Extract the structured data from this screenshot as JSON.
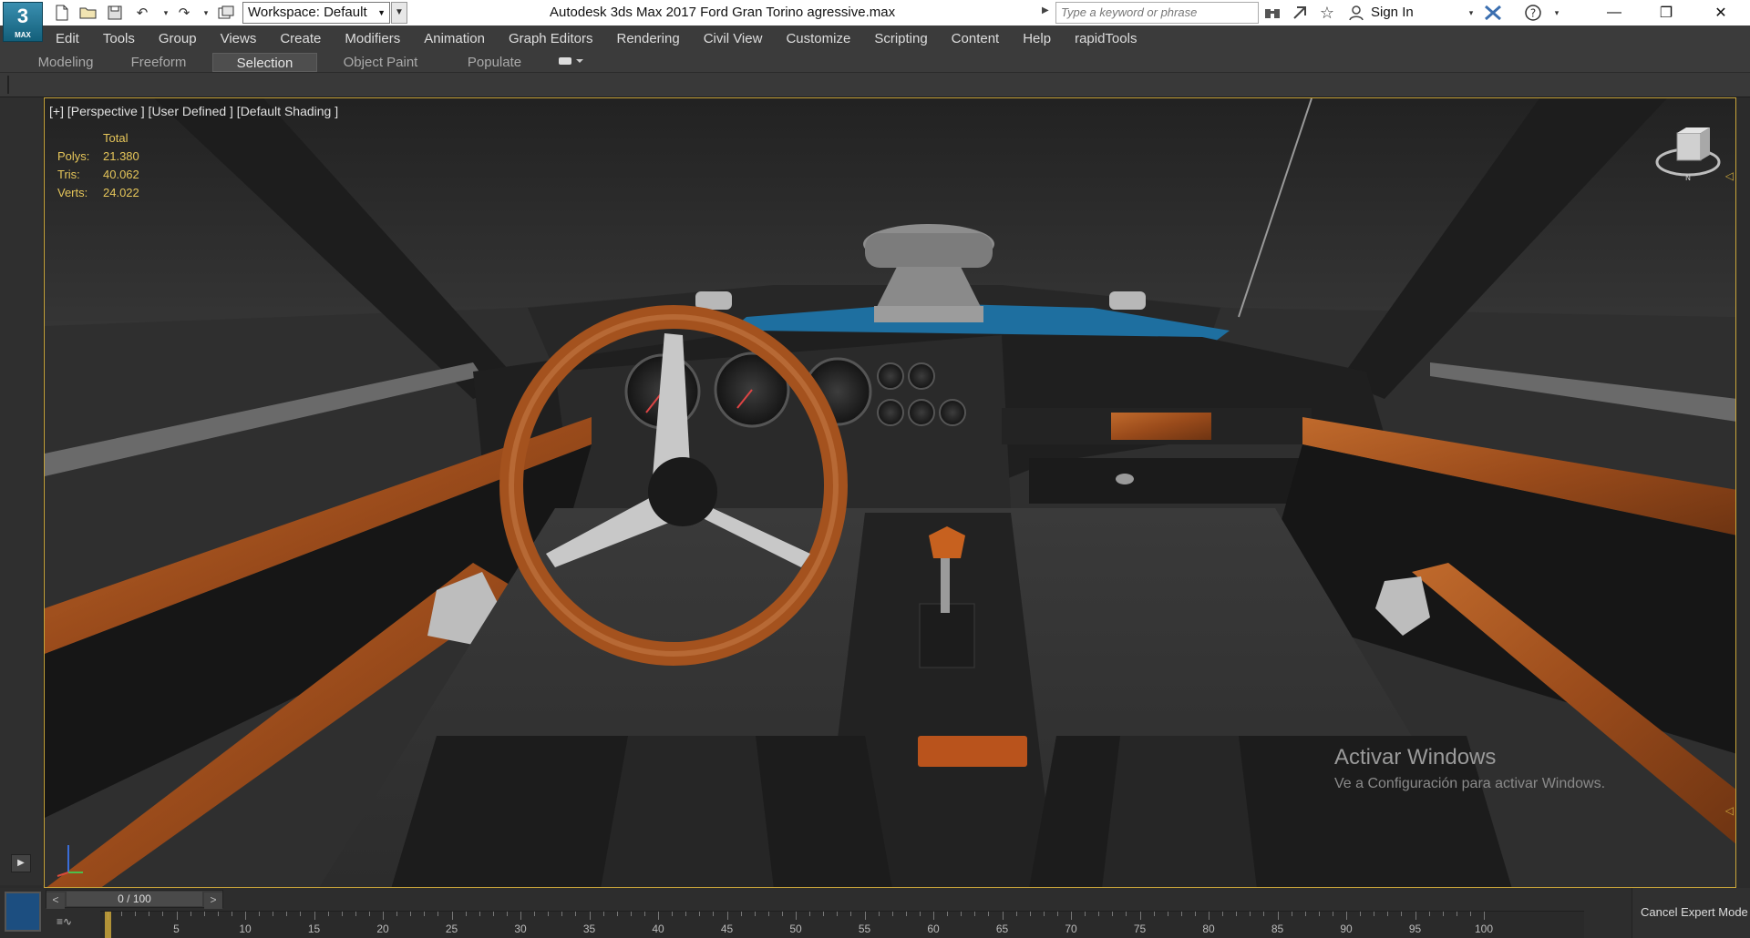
{
  "titlebar": {
    "logo_text": "3",
    "logo_sub": "MAX",
    "workspace": "Workspace: Default",
    "window_title": "Autodesk 3ds Max 2017     Ford Gran Torino agressive.max",
    "search_placeholder": "Type a keyword or phrase",
    "sign_in": "Sign In"
  },
  "menu": [
    "Edit",
    "Tools",
    "Group",
    "Views",
    "Create",
    "Modifiers",
    "Animation",
    "Graph Editors",
    "Rendering",
    "Civil View",
    "Customize",
    "Scripting",
    "Content",
    "Help",
    "rapidTools"
  ],
  "ribbon": {
    "tabs": [
      "Modeling",
      "Freeform",
      "Selection",
      "Object Paint",
      "Populate"
    ],
    "active": "Selection"
  },
  "viewport": {
    "label": "[+] [Perspective ] [User Defined ] [Default Shading ]",
    "stats": {
      "header": "Total",
      "polys_label": "Polys:",
      "polys": "21.380",
      "tris_label": "Tris:",
      "tris": "40.062",
      "verts_label": "Verts:",
      "verts": "24.022"
    },
    "viewcube_label": "N"
  },
  "watermark": {
    "title": "Activar Windows",
    "subtitle": "Ve a Configuración para activar Windows."
  },
  "timeline": {
    "value": "0 / 100",
    "prev": "<",
    "next": ">",
    "ticks": [
      "5",
      "10",
      "15",
      "20",
      "25",
      "30",
      "35",
      "40",
      "45",
      "50",
      "55",
      "60",
      "65",
      "70",
      "75",
      "80",
      "85",
      "90",
      "95",
      "100"
    ],
    "cancel_label": "Cancel Expert Mode"
  },
  "colors": {
    "accent_border": "#c9a53a",
    "stats_text": "#e6c65a",
    "wood": "#a4521e",
    "hood_blue": "#1e6fa0"
  }
}
